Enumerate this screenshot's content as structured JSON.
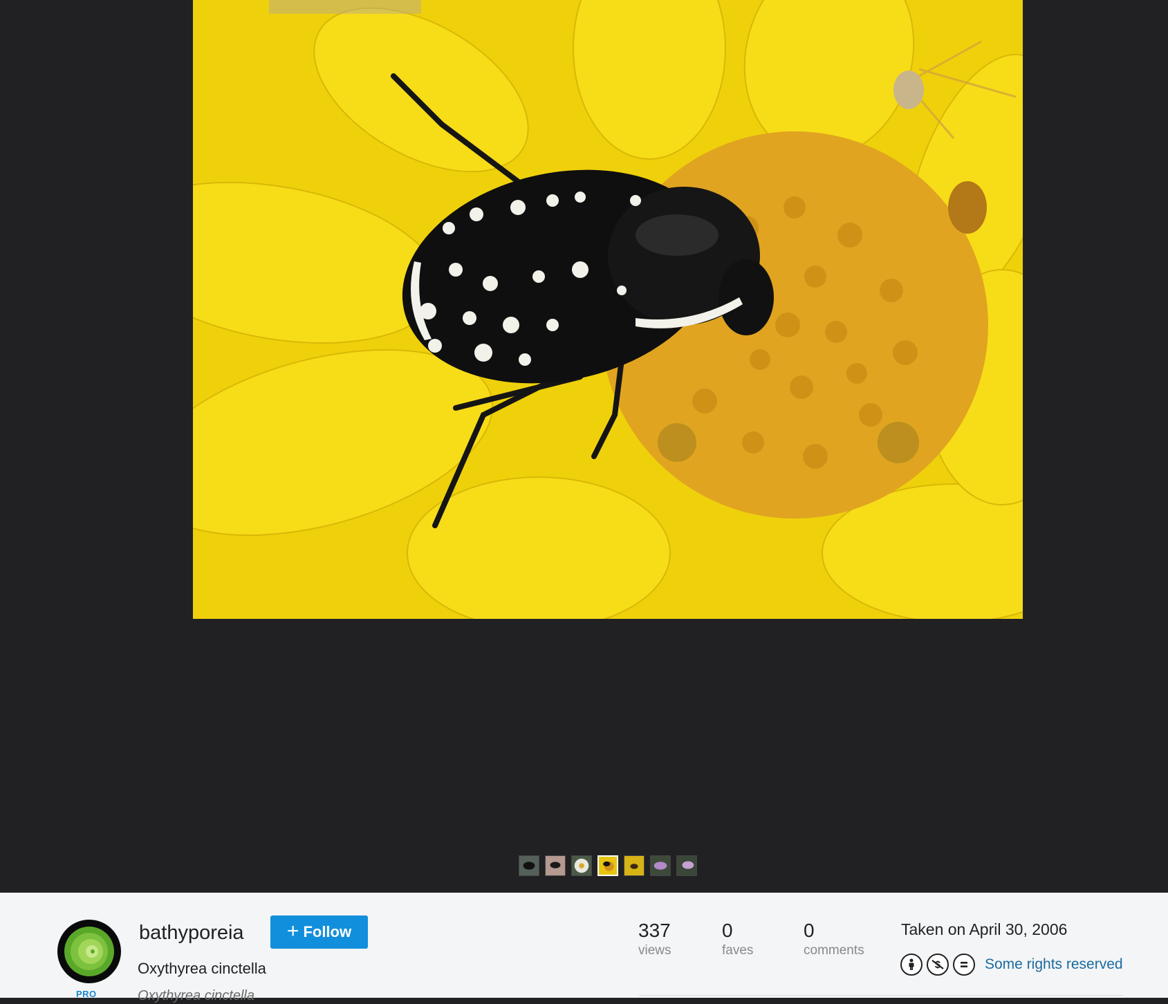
{
  "photo": {
    "subject": "beetle on yellow flower",
    "colors": {
      "petal": "#f5d00a",
      "disc": "#e3a21a",
      "beetle": "#111111",
      "background": "#212124"
    }
  },
  "filmstrip": {
    "thumbnails": [
      "thumb-beetle-1",
      "thumb-beetle-2",
      "thumb-daisy",
      "thumb-beetle-flower",
      "thumb-bee-flower",
      "thumb-purple-flower-1",
      "thumb-purple-flower-2"
    ],
    "active_index": 3
  },
  "owner": {
    "username": "bathyporeia",
    "badge": "PRO",
    "follow_label": "Follow"
  },
  "photo_info": {
    "title": "Oxythyrea cinctella",
    "description": "Oxythyrea cinctella"
  },
  "stats": {
    "views": {
      "value": "337",
      "label": "views"
    },
    "faves": {
      "value": "0",
      "label": "faves"
    },
    "comments": {
      "value": "0",
      "label": "comments"
    }
  },
  "meta": {
    "taken": "Taken on April 30, 2006",
    "license_icons": [
      "cc-by-icon",
      "cc-nc-icon",
      "cc-nd-icon"
    ],
    "license_text": "Some rights reserved"
  }
}
